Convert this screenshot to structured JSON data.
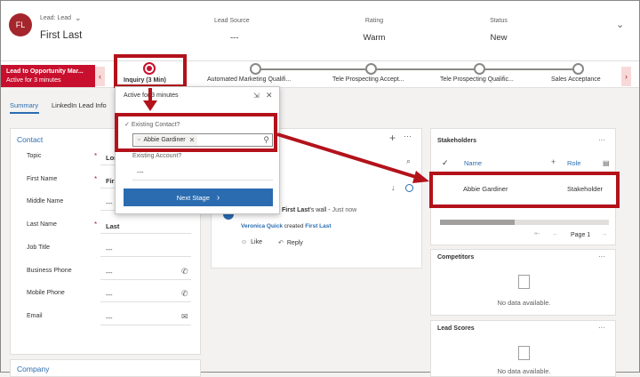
{
  "header": {
    "avatar_initials": "FL",
    "entity_label": "Lead: Lead",
    "record_name": "First Last",
    "fields": [
      {
        "label": "Lead Source",
        "value": "---"
      },
      {
        "label": "Rating",
        "value": "Warm"
      },
      {
        "label": "Status",
        "value": "New"
      }
    ]
  },
  "bpf": {
    "process_name": "Lead to Opportunity Mar...",
    "process_duration": "Active for 3 minutes",
    "stages": [
      "Inquiry  (3 Min)",
      "Automated Marketing Qualifi...",
      "Tele Prospecting Accept...",
      "Tele Prospecting Qualific...",
      "Sales Acceptance"
    ]
  },
  "tabs": [
    "Summary",
    "LinkedIn Lead Info"
  ],
  "flyout": {
    "active_for": "Active for 3 minutes",
    "existing_contact_label": "Existing Contact?",
    "contact_value": "Abbie Gardiner",
    "existing_account_label": "Existing Account?",
    "account_value": "---",
    "next_stage_label": "Next Stage"
  },
  "contact": {
    "title": "Contact",
    "fields": [
      {
        "label": "Topic",
        "value": "Lon",
        "required": "*"
      },
      {
        "label": "First Name",
        "value": "Firs",
        "required": "*"
      },
      {
        "label": "Middle Name",
        "value": "---",
        "required": ""
      },
      {
        "label": "Last Name",
        "value": "Last",
        "required": "*"
      },
      {
        "label": "Job Title",
        "value": "---",
        "required": ""
      },
      {
        "label": "Business Phone",
        "value": "---",
        "required": ""
      },
      {
        "label": "Mobile Phone",
        "value": "---",
        "required": ""
      },
      {
        "label": "Email",
        "value": "---",
        "required": ""
      }
    ]
  },
  "company": {
    "title": "Company"
  },
  "timeline": {
    "post_author": "First Last",
    "post_wall": "'s wall",
    "post_sep": " - ",
    "post_time": "Just now",
    "post_creator": "Veronica Quick",
    "post_action": "created",
    "post_target": "First Last",
    "like_label": "Like",
    "reply_label": "Reply"
  },
  "stakeholders": {
    "title": "Stakeholders",
    "col_name": "Name",
    "col_role": "Role",
    "row_name": "Abbie Gardiner",
    "row_role": "Stakeholder",
    "page_label": "Page 1"
  },
  "competitors": {
    "title": "Competitors",
    "empty": "No data available."
  },
  "lead_scores": {
    "title": "Lead Scores",
    "empty": "No data available."
  },
  "colors": {
    "accent": "#c8102e",
    "primary": "#2b6cb0",
    "redbox": "#b3121b"
  }
}
